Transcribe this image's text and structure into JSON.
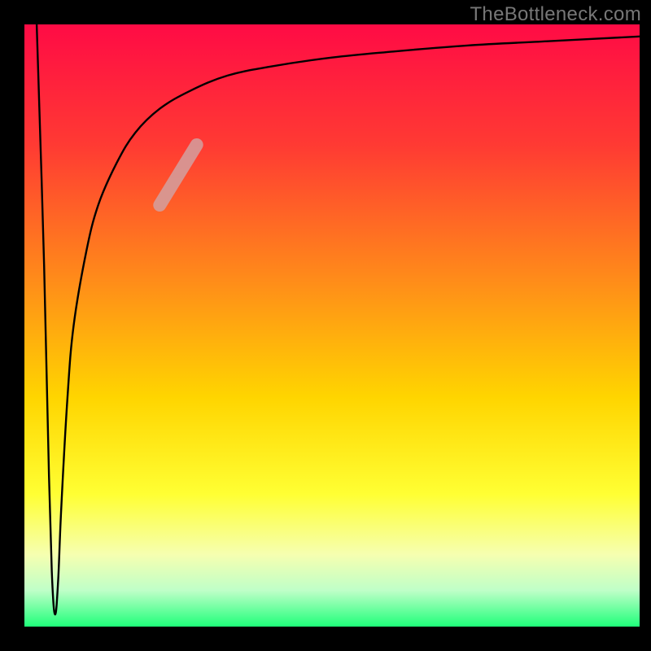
{
  "attribution": "TheBottleneck.com",
  "colors": {
    "frame": "#000000",
    "gradient_stops": [
      {
        "offset": 0.0,
        "color": "#ff0b45"
      },
      {
        "offset": 0.2,
        "color": "#ff3a33"
      },
      {
        "offset": 0.42,
        "color": "#ff8a1a"
      },
      {
        "offset": 0.62,
        "color": "#ffd500"
      },
      {
        "offset": 0.78,
        "color": "#ffff33"
      },
      {
        "offset": 0.88,
        "color": "#f6ffb0"
      },
      {
        "offset": 0.94,
        "color": "#bfffc8"
      },
      {
        "offset": 1.0,
        "color": "#1fff7a"
      }
    ],
    "curve": "#000000",
    "highlight": "rgba(210,160,160,0.85)"
  },
  "chart_data": {
    "type": "line",
    "title": "",
    "xlabel": "",
    "ylabel": "",
    "xlim": [
      0,
      100
    ],
    "ylim": [
      0,
      100
    ],
    "note": "No axes or tick labels rendered. Values are percentage estimates of the visible curve trajectory within the colored plot area.",
    "x": [
      2.0,
      3.2,
      4.0,
      4.5,
      5.0,
      5.5,
      6.0,
      7.0,
      8.0,
      10.0,
      12.0,
      15.0,
      18.0,
      22.0,
      27.0,
      33.0,
      40.0,
      50.0,
      60.0,
      72.0,
      85.0,
      100.0
    ],
    "values": [
      100.0,
      60.0,
      25.0,
      8.0,
      2.0,
      8.0,
      20.0,
      38.0,
      50.0,
      62.0,
      70.0,
      77.0,
      82.0,
      86.0,
      89.0,
      91.5,
      93.0,
      94.5,
      95.5,
      96.5,
      97.2,
      98.0
    ],
    "highlight_segment": {
      "x_range": [
        22.0,
        28.0
      ],
      "y_range": [
        70.0,
        80.0
      ]
    }
  }
}
